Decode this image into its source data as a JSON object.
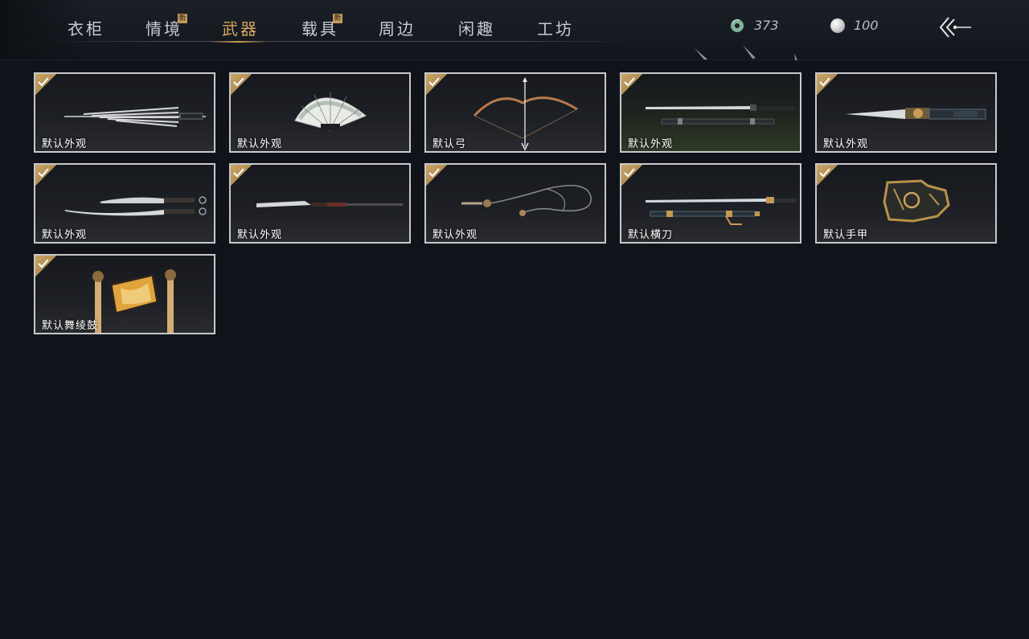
{
  "nav": {
    "tabs": [
      {
        "label": "衣柜",
        "is_new": false,
        "active": false
      },
      {
        "label": "情境",
        "is_new": true,
        "active": false
      },
      {
        "label": "武器",
        "is_new": false,
        "active": true
      },
      {
        "label": "载具",
        "is_new": true,
        "active": false
      },
      {
        "label": "周边",
        "is_new": false,
        "active": false
      },
      {
        "label": "闲趣",
        "is_new": false,
        "active": false
      },
      {
        "label": "工坊",
        "is_new": false,
        "active": false
      }
    ],
    "new_badge": "新"
  },
  "currency": {
    "jade": "373",
    "pearl": "100"
  },
  "colors": {
    "active_tab": "#d7a660",
    "check_gold": "#c8a465",
    "card_border": "#c7c8c9",
    "background": "#10141a"
  },
  "icons": {
    "jade": "jade-coin-icon",
    "pearl": "pearl-icon",
    "back": "back-arrow-icon",
    "check": "checkmark-icon"
  },
  "weapons": [
    {
      "label": "默认外观",
      "art": "umbrella-icon",
      "equipped": true
    },
    {
      "label": "默认外观",
      "art": "fan-icon",
      "equipped": true
    },
    {
      "label": "默认弓",
      "art": "bow-icon",
      "equipped": true
    },
    {
      "label": "默认外观",
      "art": "sword-scabbard-icon",
      "equipped": true
    },
    {
      "label": "默认外观",
      "art": "mech-blade-icon",
      "equipped": true
    },
    {
      "label": "默认外观",
      "art": "dual-blades-icon",
      "equipped": true
    },
    {
      "label": "默认外观",
      "art": "spear-icon",
      "equipped": true
    },
    {
      "label": "默认外观",
      "art": "rope-dart-icon",
      "equipped": true
    },
    {
      "label": "默认横刀",
      "art": "hengdao-icon",
      "equipped": true
    },
    {
      "label": "默认手甲",
      "art": "gauntlet-icon",
      "equipped": true
    },
    {
      "label": "默认舞绫鼓",
      "art": "drum-icon",
      "equipped": true
    }
  ]
}
